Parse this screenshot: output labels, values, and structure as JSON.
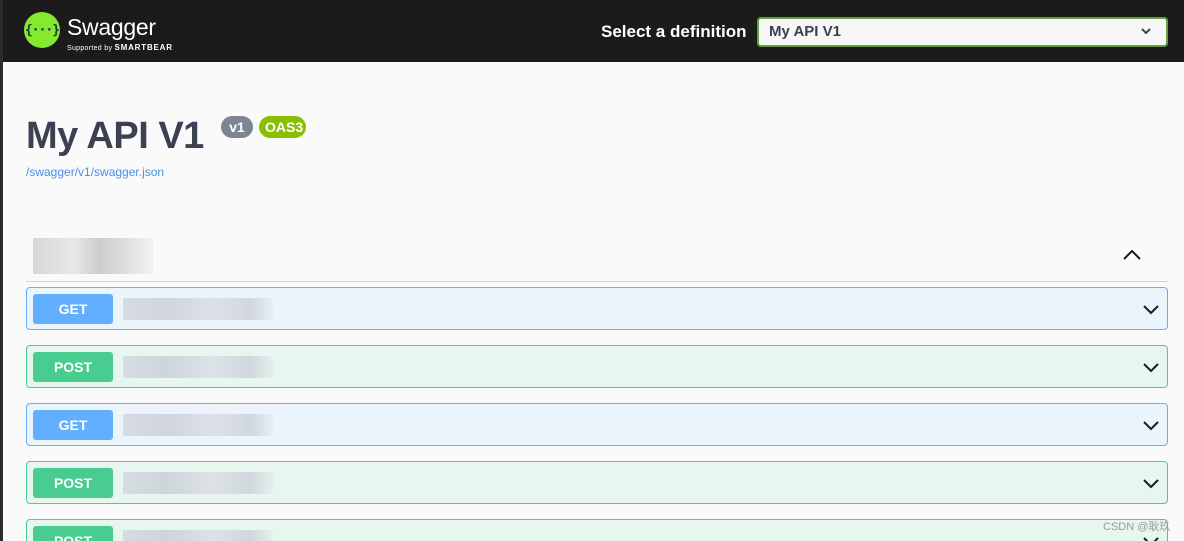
{
  "header": {
    "brand": "Swagger",
    "brand_sub_prefix": "Supported by",
    "brand_sub_name": "SMARTBEAR",
    "definition_label": "Select a definition",
    "definition_selected": "My API V1",
    "colors": {
      "bar": "#1b1b1b",
      "logo": "#85ea2d",
      "select_border": "#62a03f"
    }
  },
  "info": {
    "title": "My API V1",
    "version_badge": "v1",
    "oas_badge": "OAS3",
    "spec_url": "/swagger/v1/swagger.json"
  },
  "operations": [
    {
      "method": "GET"
    },
    {
      "method": "POST"
    },
    {
      "method": "GET"
    },
    {
      "method": "POST"
    },
    {
      "method": "POST"
    }
  ],
  "colors": {
    "get": "#61affe",
    "post": "#49cc90"
  },
  "watermark": "CSDN @耿玖"
}
